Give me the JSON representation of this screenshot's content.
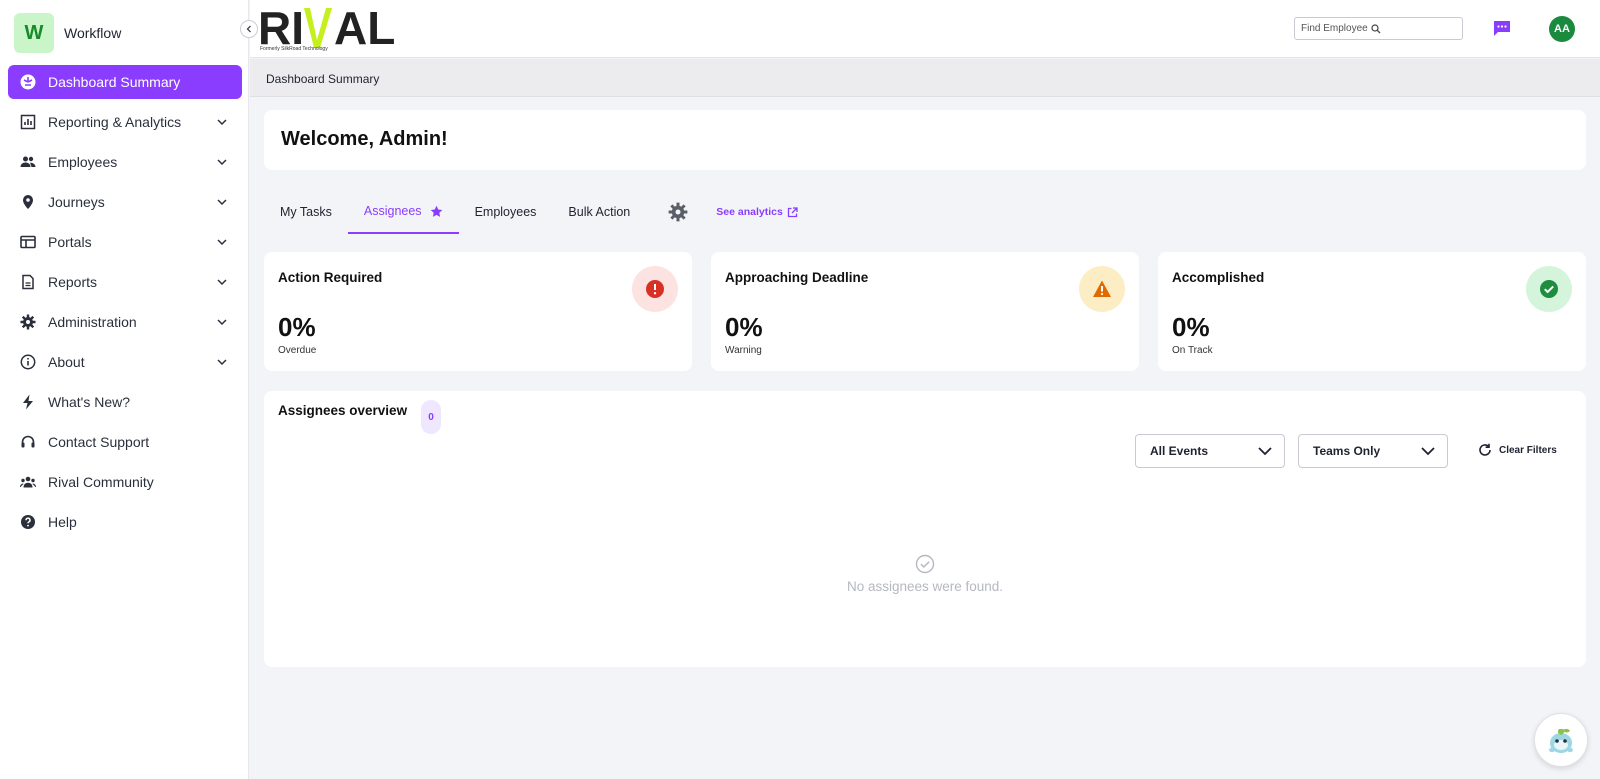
{
  "app": {
    "logo_letter": "W",
    "name": "Workflow"
  },
  "brand": {
    "name": "RIVAL",
    "tagline": "Formerly SilkRoad Technology"
  },
  "sidebar": {
    "items": [
      {
        "label": "Dashboard Summary",
        "icon": "dashboard-icon",
        "active": true
      },
      {
        "label": "Reporting & Analytics",
        "icon": "chart-icon",
        "expandable": true
      },
      {
        "label": "Employees",
        "icon": "people-icon",
        "expandable": true
      },
      {
        "label": "Journeys",
        "icon": "location-pin-icon",
        "expandable": true
      },
      {
        "label": "Portals",
        "icon": "portal-icon",
        "expandable": true
      },
      {
        "label": "Reports",
        "icon": "report-icon",
        "expandable": true
      },
      {
        "label": "Administration",
        "icon": "gear-icon",
        "expandable": true
      },
      {
        "label": "About",
        "icon": "info-icon",
        "expandable": true
      },
      {
        "label": "What's New?",
        "icon": "lightning-icon"
      },
      {
        "label": "Contact Support",
        "icon": "headset-icon"
      },
      {
        "label": "Rival Community",
        "icon": "community-icon"
      },
      {
        "label": "Help",
        "icon": "help-icon"
      }
    ]
  },
  "header": {
    "search_placeholder": "Find Employee",
    "avatar_initials": "AA"
  },
  "breadcrumb": "Dashboard Summary",
  "welcome": "Welcome, Admin!",
  "tabs": [
    {
      "label": "My Tasks"
    },
    {
      "label": "Assignees",
      "active": true,
      "favorite": true
    },
    {
      "label": "Employees"
    },
    {
      "label": "Bulk Action"
    }
  ],
  "see_analytics": "See analytics",
  "cards": [
    {
      "title": "Action Required",
      "value": "0%",
      "sub": "Overdue",
      "icon": "alert-circle-icon",
      "color": "#d93025",
      "bg": "#fde2e2"
    },
    {
      "title": "Approaching Deadline",
      "value": "0%",
      "sub": "Warning",
      "icon": "warning-triangle-icon",
      "color": "#e06a00",
      "bg": "#fdedc4"
    },
    {
      "title": "Accomplished",
      "value": "0%",
      "sub": "On Track",
      "icon": "check-circle-icon",
      "color": "#1e8e3e",
      "bg": "#d4f5dc"
    }
  ],
  "overview": {
    "title": "Assignees overview",
    "count": "0",
    "filter_events": "All Events",
    "filter_teams": "Teams Only",
    "clear_filters": "Clear Filters",
    "empty_message": "No assignees were found."
  },
  "colors": {
    "accent": "#8b3dff",
    "brand_lime": "#c6ef1e"
  }
}
